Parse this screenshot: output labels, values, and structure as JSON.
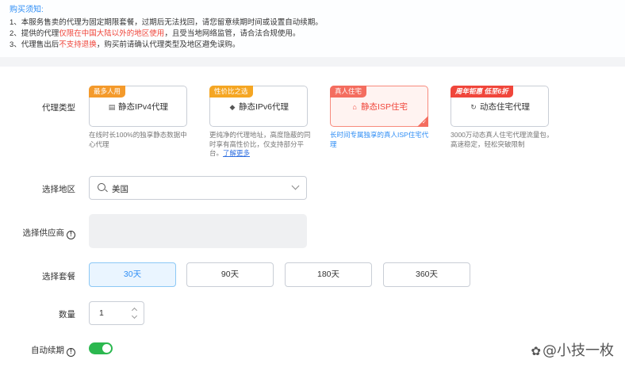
{
  "notice": {
    "title": "购买须知:",
    "line1": "1、本服务售卖的代理为固定期限套餐，过期后无法找回，请您留意续期时间或设置自动续期。",
    "line2_pre": "2、提供的代理",
    "line2_red": "仅限在中国大陆以外的地区使用",
    "line2_post": "，且受当地网络监管，请合法合规使用。",
    "line3_pre": "3、代理售出后",
    "line3_red": "不支持退换",
    "line3_post": "，购买前请确认代理类型及地区避免误购。"
  },
  "labels": {
    "proxy_type": "代理类型",
    "region": "选择地区",
    "supplier": "选择供应商",
    "plan": "选择套餐",
    "quantity": "数量",
    "auto_renew": "自动续期"
  },
  "proxy_types": [
    {
      "badge": "最多人用",
      "badge_color": "#f49a2b",
      "icon": "server-icon",
      "name": "静态IPv4代理",
      "desc": "在线时长100%的独享静态数据中心代理"
    },
    {
      "badge": "性价比之选",
      "badge_color": "#f5a623",
      "icon": "cube-icon",
      "name": "静态IPv6代理",
      "desc": "更纯净的代理地址，高度隐蔽的同时享有高性价比，仅支持部分平台。",
      "link": "了解更多"
    },
    {
      "badge": "真人住宅",
      "badge_color": "#f46d5f",
      "icon": "home-icon",
      "name": "静态ISP住宅",
      "desc": "长时间专属独享的真人ISP住宅代理",
      "selected": true
    },
    {
      "badge": "周年钜惠 低至6折",
      "badge_color": "#f0463b",
      "icon": "refresh-icon",
      "name": "动态住宅代理",
      "desc": "3000万动态真人住宅代理流量包，高速稳定，轻松突破限制"
    }
  ],
  "region": {
    "value": "美国"
  },
  "plans": [
    "30天",
    "90天",
    "180天",
    "360天"
  ],
  "selected_plan": "30天",
  "quantity": "1",
  "auto_renew": true,
  "watermark": "@小技一枚",
  "help_glyph": "!",
  "checkmark": "✓"
}
